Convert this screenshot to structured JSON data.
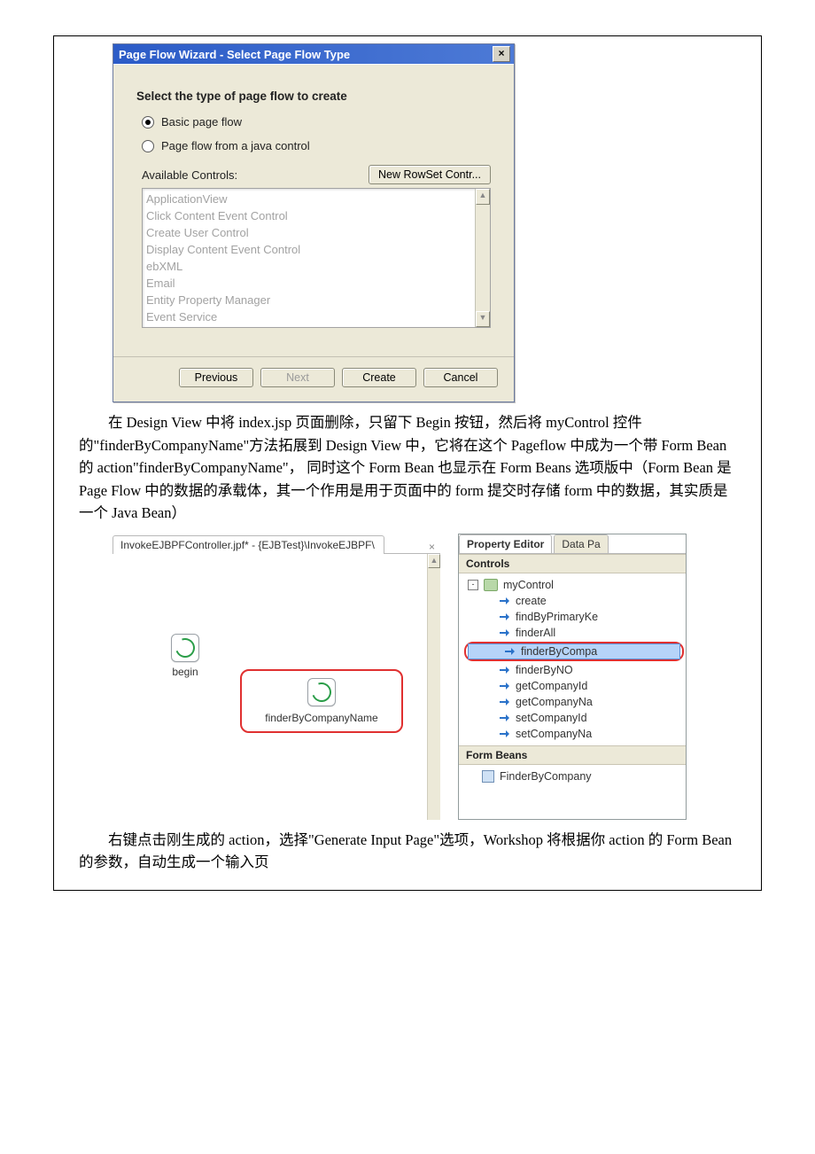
{
  "dialog": {
    "title": "Page Flow Wizard - Select Page Flow Type",
    "close": "×",
    "section_label": "Select the type of page flow to create",
    "radio_basic": "Basic page flow",
    "radio_control": "Page flow from a java control",
    "available_label": "Available Controls:",
    "new_rowset_btn": "New RowSet Contr...",
    "controls": [
      "ApplicationView",
      "Click Content Event Control",
      "Create User Control",
      "Display Content Event Control",
      "ebXML",
      "Email",
      "Entity Property Manager",
      "Event Service"
    ],
    "btn_prev": "Previous",
    "btn_next": "Next",
    "btn_create": "Create",
    "btn_cancel": "Cancel"
  },
  "para1": "在 Design View 中将 index.jsp 页面删除，只留下 Begin 按钮，然后将 myControl 控件的\"finderByCompanyName\"方法拓展到 Design View 中，它将在这个 Pageflow 中成为一个带 Form Bean 的 action\"finderByCompanyName\"， 同时这个 Form Bean 也显示在 Form Beans 选项版中（Form Bean 是 Page Flow 中的数据的承载体，其一个作用是用于页面中的 form 提交时存储 form 中的数据，其实质是一个 Java Bean）",
  "designer": {
    "tab_label": "InvokeEJBPFController.jpf* - {EJBTest}\\InvokeEJBPF\\",
    "tab_close": "×",
    "begin_label": "begin",
    "action_label": "finderByCompanyName"
  },
  "prop": {
    "tab_editor": "Property Editor",
    "tab_data": "Data Pa",
    "controls_header": "Controls",
    "root": "myControl",
    "expander": "-",
    "methods": [
      "create",
      "findByPrimaryKe",
      "finderAll",
      "finderByCompa",
      "finderByNO",
      "getCompanyId",
      "getCompanyNa",
      "setCompanyId",
      "setCompanyNa"
    ],
    "formbeans_header": "Form Beans",
    "formbean": "FinderByCompany"
  },
  "para2": "右键点击刚生成的 action，选择\"Generate Input Page\"选项，Workshop 将根据你 action 的 Form Bean 的参数，自动生成一个输入页"
}
